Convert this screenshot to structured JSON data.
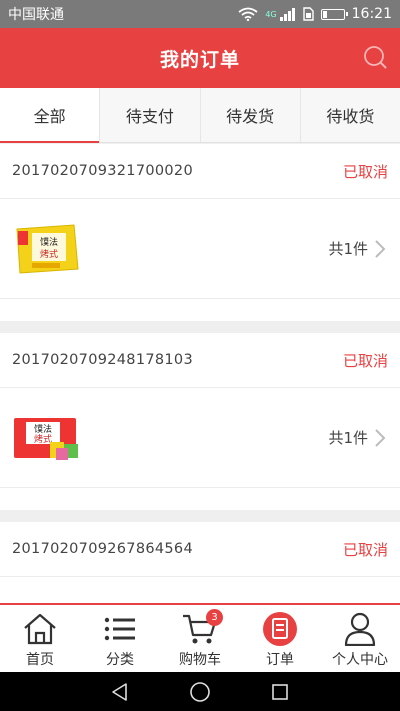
{
  "status_bar": {
    "carrier": "中国联通",
    "time": "16:21",
    "network": "4G"
  },
  "header": {
    "title": "我的订单"
  },
  "tabs": [
    {
      "label": "全部"
    },
    {
      "label": "待支付"
    },
    {
      "label": "待发货"
    },
    {
      "label": "待收货"
    }
  ],
  "orders": [
    {
      "order_no": "2017020709321700020",
      "status": "已取消",
      "count_label": "共1件"
    },
    {
      "order_no": "2017020709248178103",
      "status": "已取消",
      "count_label": "共1件"
    },
    {
      "order_no": "2017020709267864564",
      "status": "已取消",
      "count_label": ""
    }
  ],
  "product_text": {
    "line1": "馍法",
    "line2": "烤式"
  },
  "tabbar": {
    "items": [
      {
        "label": "首页"
      },
      {
        "label": "分类"
      },
      {
        "label": "购物车",
        "badge": "3"
      },
      {
        "label": "订单"
      },
      {
        "label": "个人中心"
      }
    ]
  },
  "colors": {
    "accent": "#e84142",
    "status_bar": "#7a7a7a"
  }
}
